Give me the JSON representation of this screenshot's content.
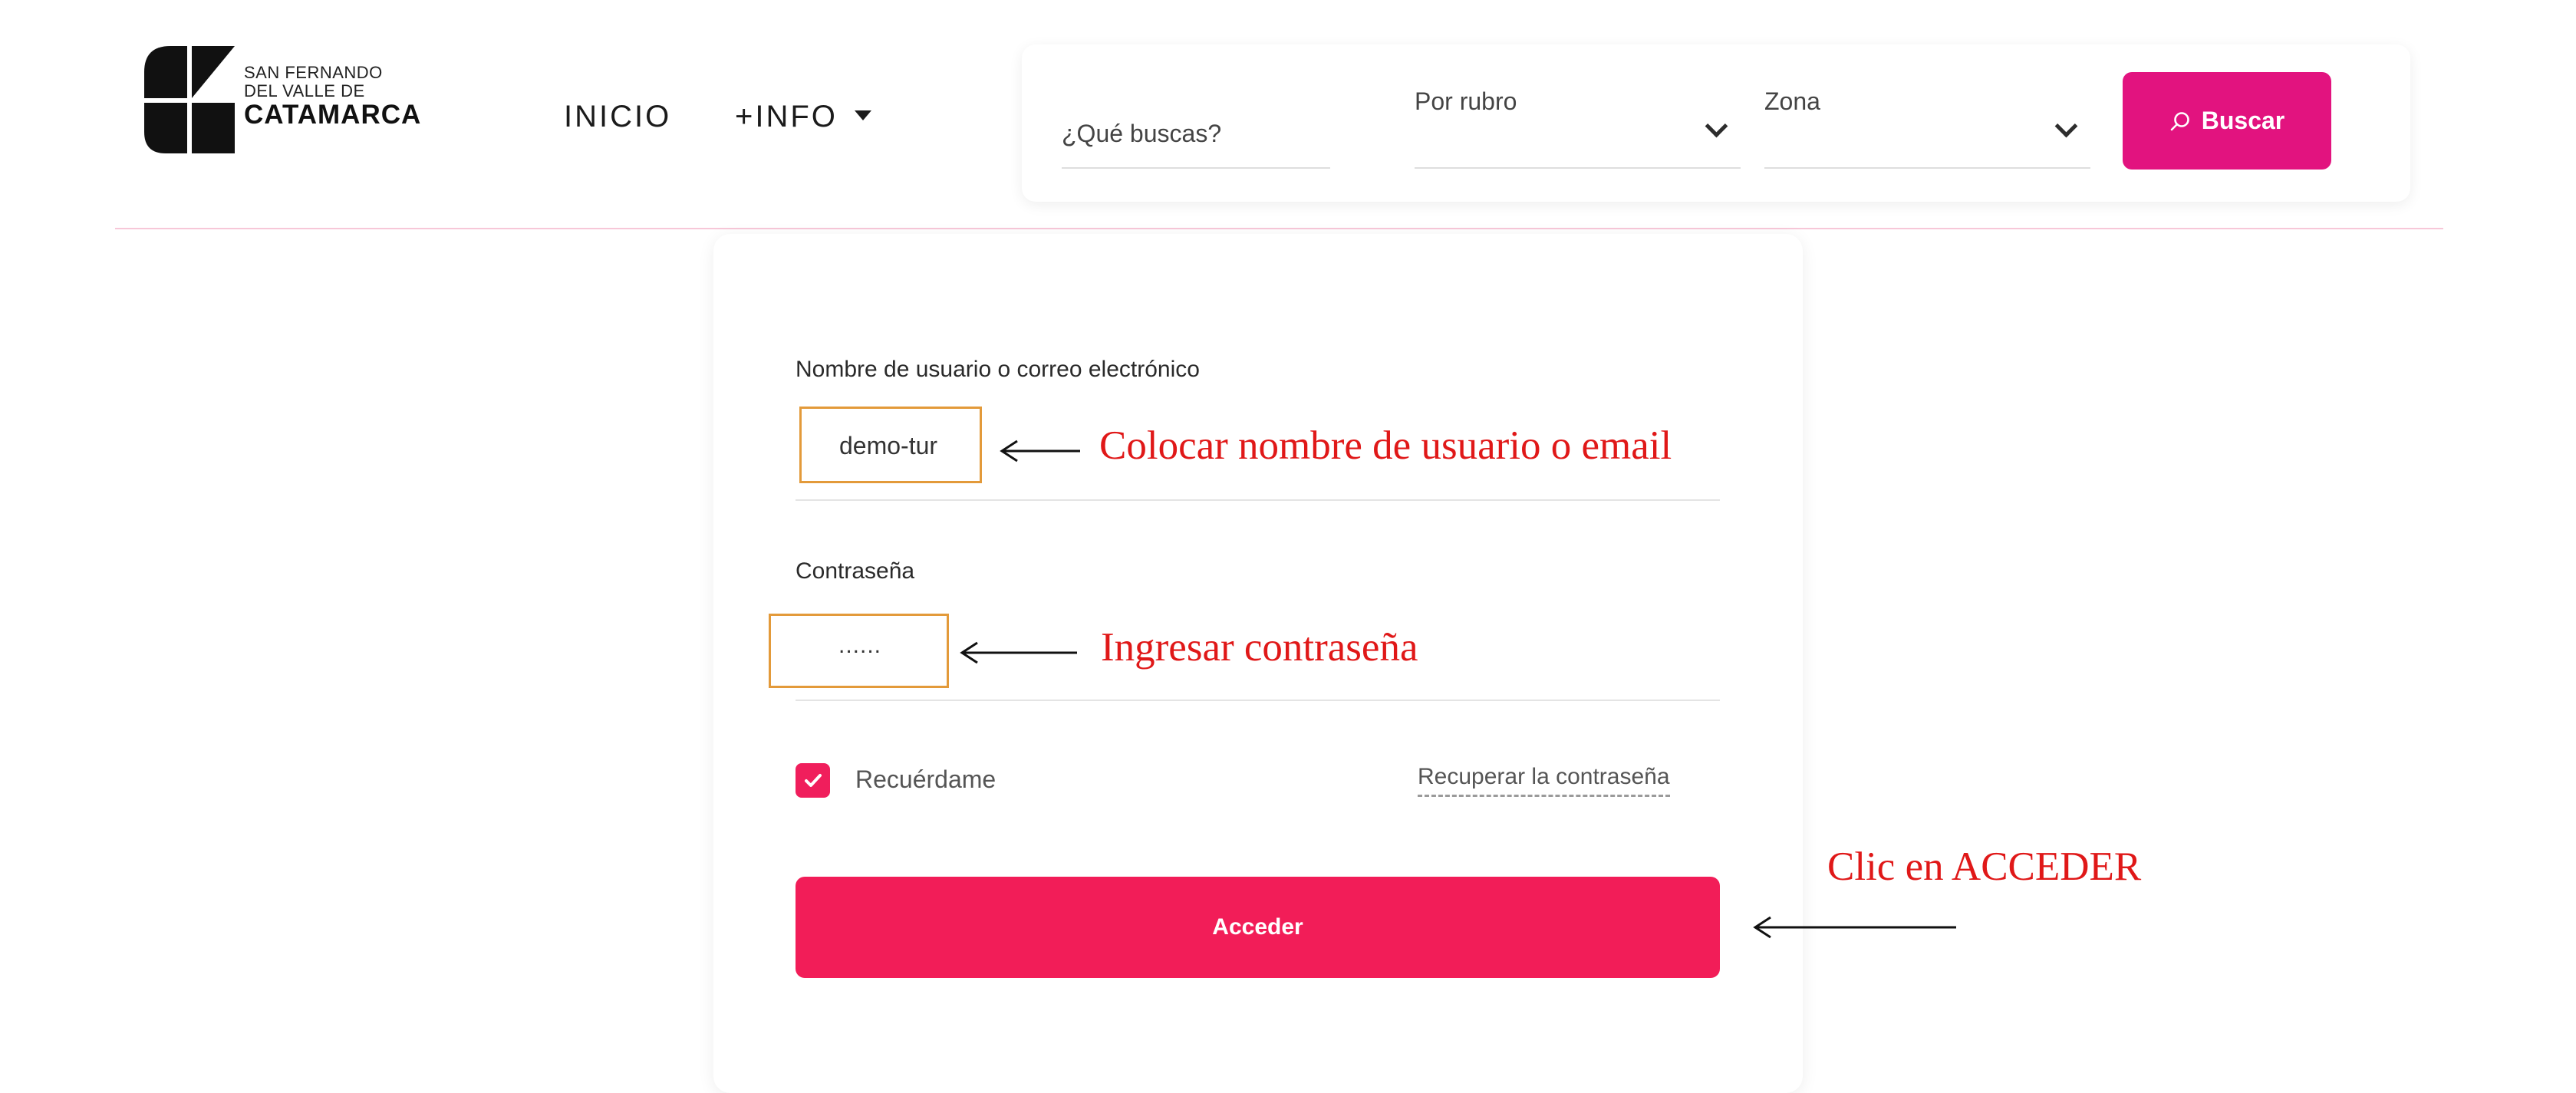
{
  "header": {
    "logo": {
      "line1": "SAN FERNANDO",
      "line2": "DEL VALLE DE",
      "line3": "CATAMARCA"
    },
    "nav": {
      "inicio": "INICIO",
      "info": "+INFO"
    },
    "search": {
      "query_placeholder": "¿Qué buscas?",
      "rubro_label": "Por rubro",
      "zona_label": "Zona",
      "button_label": "Buscar"
    }
  },
  "login": {
    "username_label": "Nombre de usuario o correo electrónico",
    "username_value": "demo-tur",
    "password_label": "Contraseña",
    "password_value": "......",
    "remember_label": "Recuérdame",
    "remember_checked": true,
    "recover_link": "Recuperar la contraseña",
    "submit_label": "Acceder"
  },
  "annotations": {
    "username_hint": "Colocar nombre de usuario o email",
    "password_hint": "Ingresar contraseña",
    "submit_hint": "Clic en ACCEDER"
  },
  "colors": {
    "brand_pink": "#e2137f",
    "submit_red": "#f21d58",
    "annotation_red": "#e01818",
    "highlight_orange": "#e39a3a"
  },
  "icons": {
    "logo": "san-fernando-logo-icon",
    "search_button": "magnifier-icon",
    "dropdown": "chevron-down-icon",
    "checkbox": "check-icon",
    "annotation": "arrow-left-icon"
  }
}
